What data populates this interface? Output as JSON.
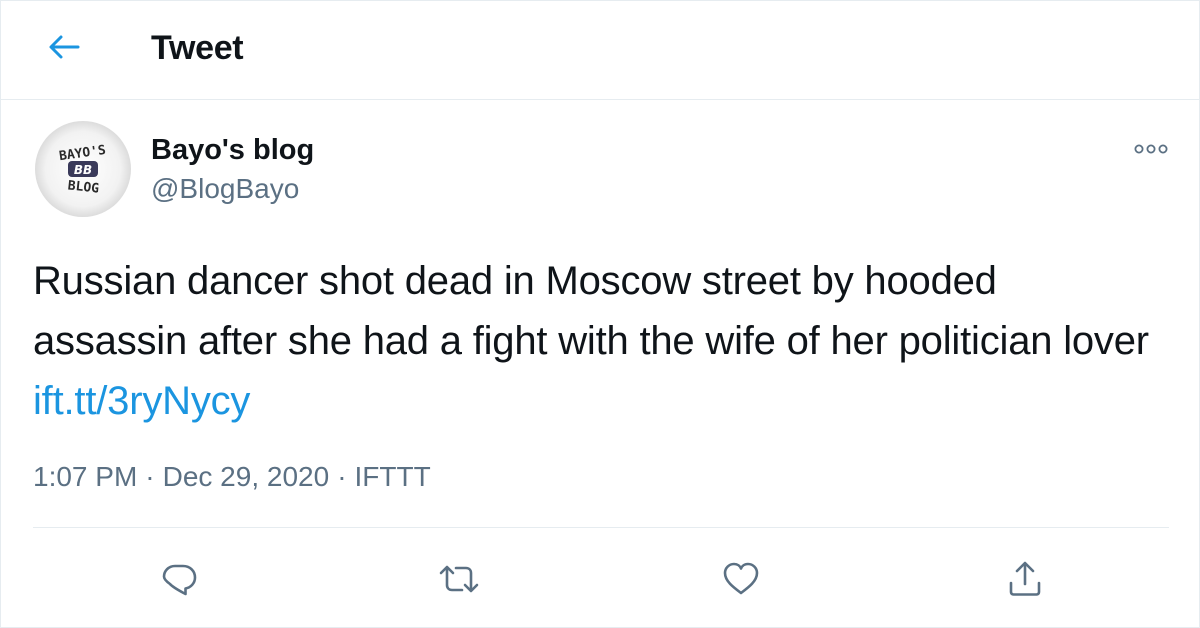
{
  "header": {
    "title": "Tweet",
    "back_icon": "arrow-left-icon"
  },
  "author": {
    "name": "Bayo's blog",
    "handle": "@BlogBayo",
    "avatar_text": {
      "top": "BAYO'S",
      "middle": "BB",
      "bottom": "BLOG"
    }
  },
  "more_icon": "more-options-icon",
  "tweet": {
    "text": "Russian dancer shot dead in Moscow street by hooded assassin after she had a fight with the wife of her politician lover",
    "link": "ift.tt/3ryNycy"
  },
  "meta": {
    "time": "1:07 PM",
    "date": "Dec 29, 2020",
    "source": "IFTTT",
    "separator": "·"
  },
  "actions": [
    {
      "icon": "reply-icon"
    },
    {
      "icon": "retweet-icon"
    },
    {
      "icon": "like-icon"
    },
    {
      "icon": "share-icon"
    }
  ],
  "colors": {
    "accent": "#1b95e0",
    "muted": "#5b7083",
    "text": "#0f1419",
    "border": "#e6ecf0"
  }
}
